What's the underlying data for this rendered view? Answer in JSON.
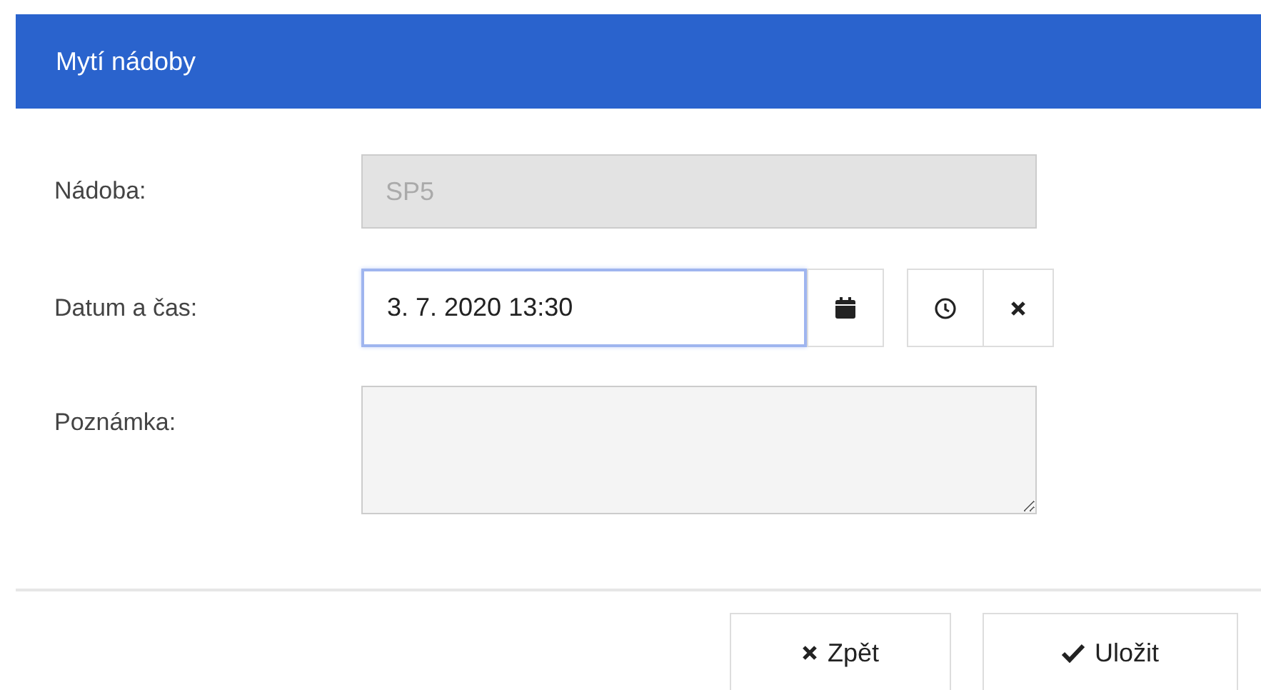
{
  "dialog": {
    "title": "Mytí nádoby"
  },
  "fields": [
    {
      "kind": "text",
      "label": "Nádoba:",
      "value": "SP5",
      "disabled": true
    },
    {
      "kind": "datetime",
      "label": "Datum a čas:",
      "value": "3. 7. 2020 13:30",
      "focused": true
    },
    {
      "kind": "textarea",
      "label": "Poznámka:"
    }
  ],
  "buttons": [
    {
      "kind": "cancel",
      "label": "Zpět"
    },
    {
      "kind": "save",
      "label": "Uložit"
    }
  ]
}
